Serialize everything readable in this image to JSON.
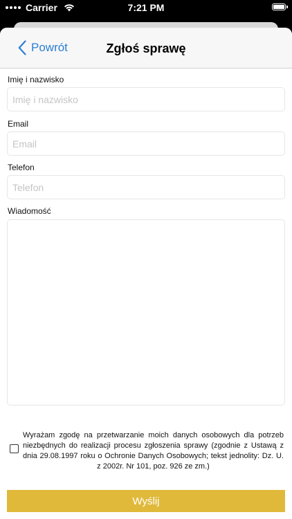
{
  "status_bar": {
    "carrier": "Carrier",
    "time": "7:21 PM"
  },
  "nav": {
    "back_label": "Powrót",
    "title": "Zgłoś sprawę"
  },
  "form": {
    "name": {
      "label": "Imię i nazwisko",
      "placeholder": "Imię i nazwisko",
      "value": ""
    },
    "email": {
      "label": "Email",
      "placeholder": "Email",
      "value": ""
    },
    "phone": {
      "label": "Telefon",
      "placeholder": "Telefon",
      "value": ""
    },
    "message": {
      "label": "Wiadomość",
      "value": ""
    }
  },
  "consent": {
    "checked": false,
    "text": "Wyrażam zgodę na przetwarzanie moich danych osobowych dla potrzeb niezbędnych do realizacji procesu zgłoszenia sprawy (zgodnie z Ustawą z dnia 29.08.1997 roku o Ochronie Danych Osobowych; tekst jednolity: Dz. U. z 2002r. Nr 101, poz. 926 ze zm.)"
  },
  "submit_label": "Wyślij",
  "colors": {
    "accent": "#2b7fd4",
    "submit_bg": "#e0b93b"
  }
}
